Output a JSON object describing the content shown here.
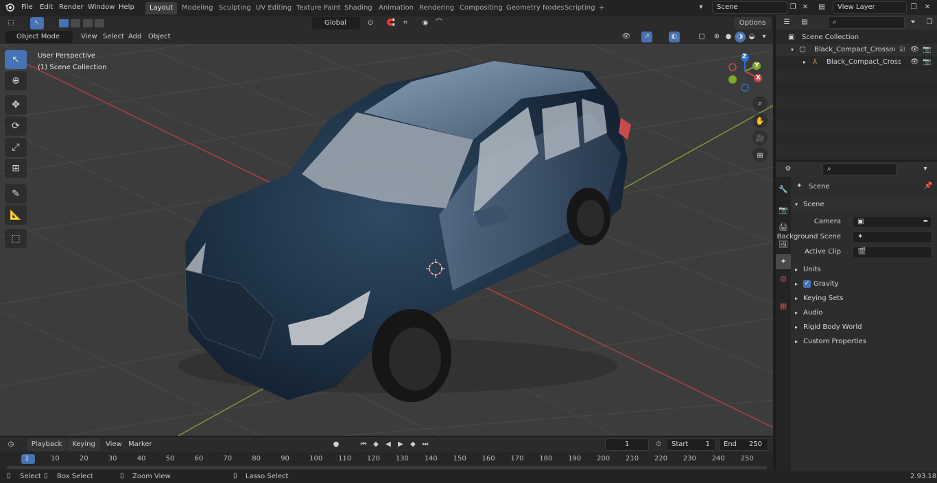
{
  "topbar": {
    "menus": [
      "File",
      "Edit",
      "Render",
      "Window",
      "Help"
    ],
    "workspaces": [
      "Layout",
      "Modeling",
      "Sculpting",
      "UV Editing",
      "Texture Paint",
      "Shading",
      "Animation",
      "Rendering",
      "Compositing",
      "Geometry Nodes",
      "Scripting"
    ],
    "active_workspace": "Layout",
    "add_tab": "+",
    "scene_name": "Scene",
    "view_layer": "View Layer"
  },
  "viewport_header": {
    "mode": "Object Mode",
    "menus": [
      "View",
      "Select",
      "Add",
      "Object"
    ],
    "transform_orientation": "Global",
    "options_label": "Options"
  },
  "viewport": {
    "perspective_label": "User Perspective",
    "collection_label": "(1) Scene Collection",
    "gizmo_axes": {
      "x": "X",
      "y": "Y",
      "z": "Z"
    }
  },
  "outliner": {
    "root": "Scene Collection",
    "items": [
      {
        "label": "Black_Compact_Crossover_SUV",
        "depth": 1
      },
      {
        "label": "Black_Compact_Crossover",
        "depth": 2
      }
    ]
  },
  "properties": {
    "context": "Scene",
    "section_title": "Scene",
    "fields": [
      {
        "label": "Camera",
        "value": ""
      },
      {
        "label": "Background Scene",
        "value": ""
      },
      {
        "label": "Active Clip",
        "value": ""
      }
    ],
    "panels": [
      "Units",
      "Gravity",
      "Keying Sets",
      "Audio",
      "Rigid Body World",
      "Custom Properties"
    ],
    "gravity_checked": true
  },
  "timeline": {
    "menus": [
      "Playback",
      "Keying",
      "View",
      "Marker"
    ],
    "current_frame": "1",
    "start_label": "Start",
    "start_value": "1",
    "end_label": "End",
    "end_value": "250",
    "ticks": [
      "1",
      "10",
      "20",
      "30",
      "40",
      "50",
      "60",
      "70",
      "80",
      "90",
      "100",
      "110",
      "120",
      "130",
      "140",
      "150",
      "160",
      "170",
      "180",
      "190",
      "200",
      "210",
      "220",
      "230",
      "240",
      "250"
    ]
  },
  "statusbar": {
    "items": [
      "Select",
      "Box Select",
      "Zoom View",
      "Lasso Select"
    ],
    "version": "2.93.18"
  },
  "colors": {
    "accent": "#4772b3",
    "x_axis": "#c84a4a",
    "y_axis": "#7fa82e",
    "z_axis": "#2e6fd0"
  }
}
